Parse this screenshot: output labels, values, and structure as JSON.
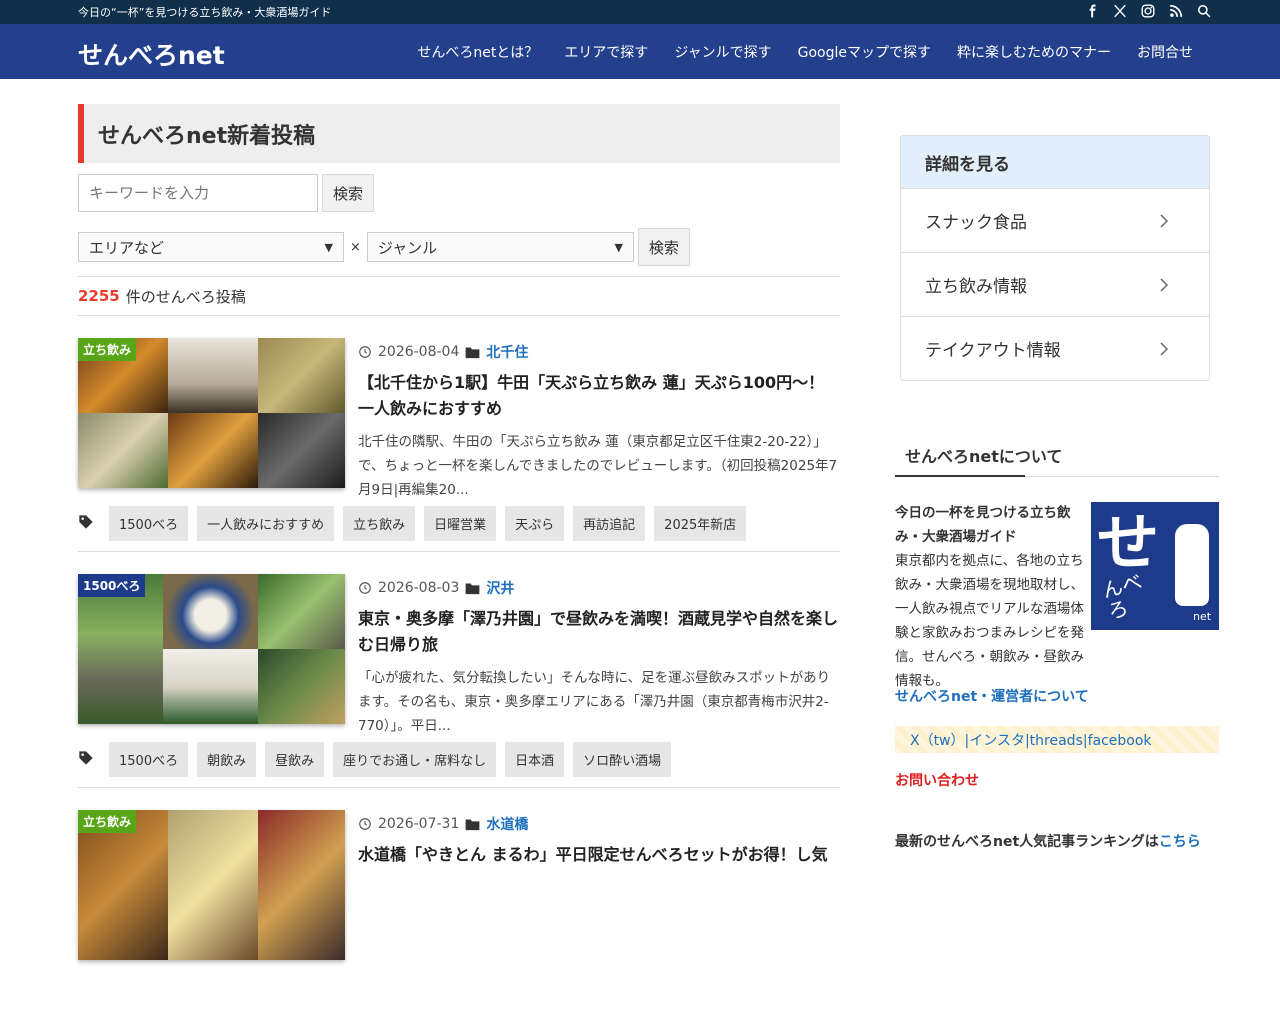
{
  "topbar": {
    "tagline": "今日の“一杯”を見つける立ち飲み・大衆酒場ガイド",
    "icons": [
      "facebook-icon",
      "x-icon",
      "instagram-icon",
      "rss-icon",
      "search-icon"
    ]
  },
  "nav": {
    "logo": "せんべろnet",
    "items": [
      "せんべろnetとは？",
      "エリアで探す",
      "ジャンルで探す",
      "Googleマップで探す",
      "粋に楽しむためのマナー",
      "お問合せ"
    ]
  },
  "main": {
    "heading": "せんべろnet新着投稿",
    "search_placeholder": "キーワードを入力",
    "search_button": "検索",
    "area_select": "エリアなど",
    "times": "×",
    "genre_select": "ジャンル",
    "filter_button": "検索",
    "count": "2255",
    "count_label": "件のせんべろ投稿"
  },
  "posts": [
    {
      "badge": "立ち飲み",
      "badge_color": "#58a618",
      "date": "2026-08-04",
      "category": "北千住",
      "title": "【北千住から1駅】牛田「天ぷら立ち飲み 蓮」天ぷら100円〜！一人飲みにおすすめ",
      "excerpt": "北千住の隣駅、牛田の「天ぷら立ち飲み 蓮（東京都足立区千住東2-20-22）」で、ちょっと一杯を楽しんできましたのでレビューします。（初回投稿2025年7月9日|再編集20...",
      "tags": [
        "1500べろ",
        "一人飲みにおすすめ",
        "立ち飲み",
        "日曜営業",
        "天ぷら",
        "再訪追記",
        "2025年新店"
      ]
    },
    {
      "badge": "1500べろ",
      "badge_color": "#1e3a8a",
      "date": "2026-08-03",
      "category": "沢井",
      "title": "東京・奥多摩「澤乃井園」で昼飲みを満喫！酒蔵見学や自然を楽しむ日帰り旅",
      "excerpt": "「心が疲れた、気分転換したい」そんな時に、足を運ぶ昼飲みスポットがあります。その名も、東京・奥多摩エリアにある「澤乃井園（東京都青梅市沢井2-770）」。平日...",
      "tags": [
        "1500べろ",
        "朝飲み",
        "昼飲み",
        "座りでお通し・席料なし",
        "日本酒",
        "ソロ酔い酒場"
      ]
    },
    {
      "badge": "立ち飲み",
      "badge_color": "#58a618",
      "date": "2026-07-31",
      "category": "水道橋",
      "title": "水道橋「やきとん まるわ」平日限定せんべろセットがお得！し気",
      "excerpt": "",
      "tags": []
    }
  ],
  "sidebar": {
    "box_heading": "詳細を見る",
    "items": [
      "スナック食品",
      "立ち飲み情報",
      "テイクアウト情報"
    ],
    "about_heading": "せんべろnetについて",
    "about_lead": "今日の一杯を見つける立ち飲み・大衆酒場ガイド",
    "about_text": "東京都内を拠点に、各地の立ち飲み・大衆酒場を現地取材し、一人飲み視点でリアルな酒場体験と家飲みおつまみレシピを発信。せんべろ・朝飲み・昼飲み情報も。",
    "logo_main": "せ",
    "logo_sub": "んべろ",
    "logo_net": "net",
    "operator": "せんべろnet・運営者について",
    "social": "X（tw）|インスタ|threads|facebook",
    "contact": "お問い合わせ",
    "ranking": "最新のせんべろnet人気記事ランキングは",
    "ranking_link": "こちら"
  }
}
